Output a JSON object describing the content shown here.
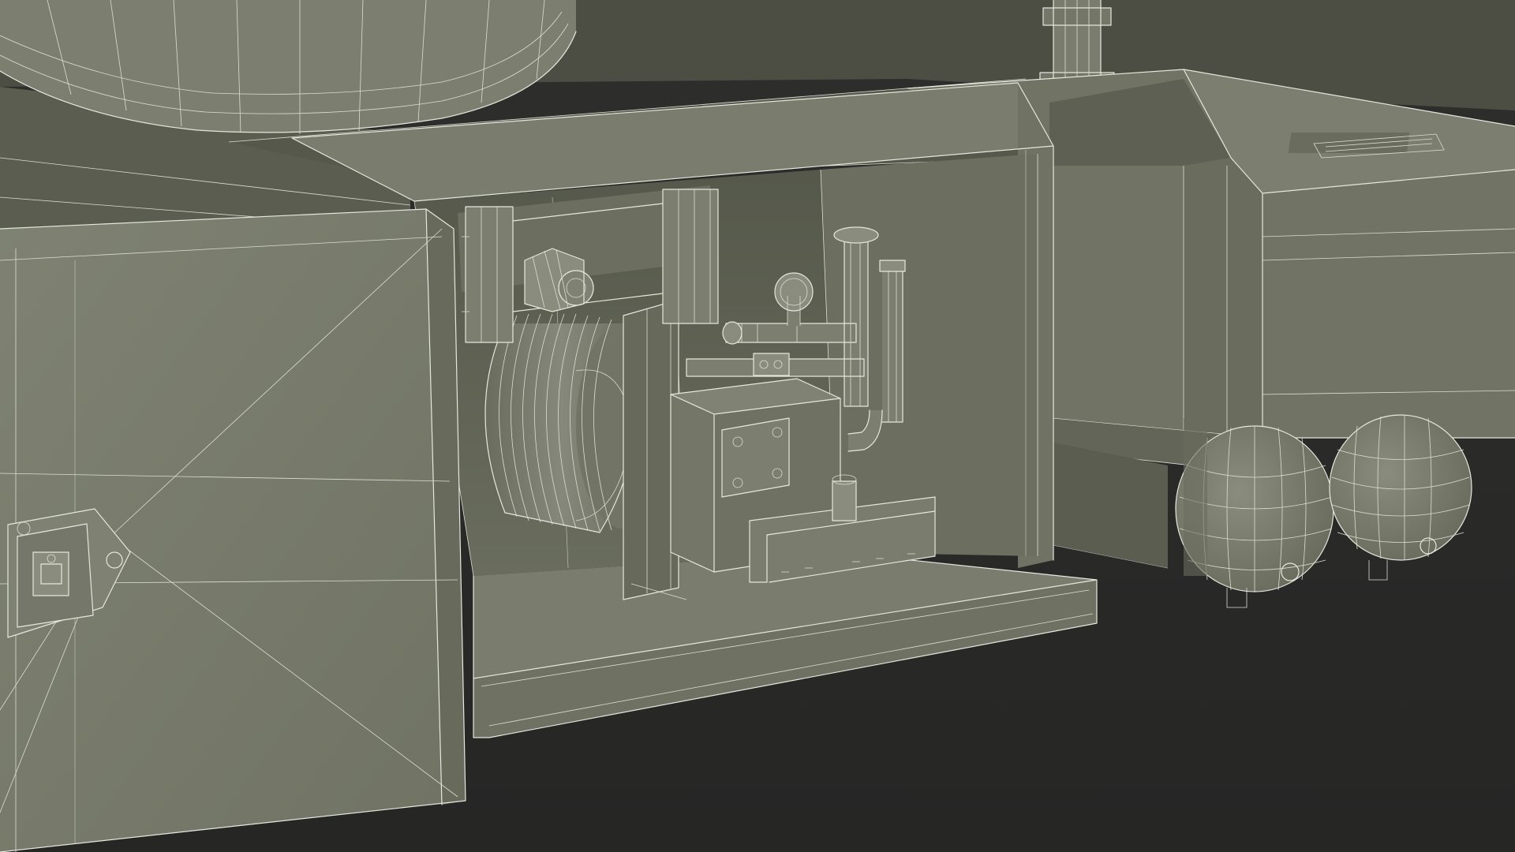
{
  "scene": {
    "description_visible": "",
    "colors": {
      "background": "#2a2a29",
      "surface_light": "#7d8070",
      "surface_mid": "#6f7263",
      "surface_dark": "#5e6153",
      "surface_shadow": "#4e5145",
      "wireframe": "#e6e7de"
    },
    "objects": [
      {
        "name": "compartment-door-panel"
      },
      {
        "name": "door-latch-handle"
      },
      {
        "name": "open-equipment-compartment"
      },
      {
        "name": "hose-reel"
      },
      {
        "name": "reel-roller-guide"
      },
      {
        "name": "pump-unit"
      },
      {
        "name": "pressure-gauge"
      },
      {
        "name": "pipe-manifold"
      },
      {
        "name": "mounting-rail"
      },
      {
        "name": "storage-box-right"
      },
      {
        "name": "air-tank-left"
      },
      {
        "name": "air-tank-right"
      },
      {
        "name": "top-tank-dome"
      },
      {
        "name": "exhaust-pipe"
      }
    ]
  }
}
